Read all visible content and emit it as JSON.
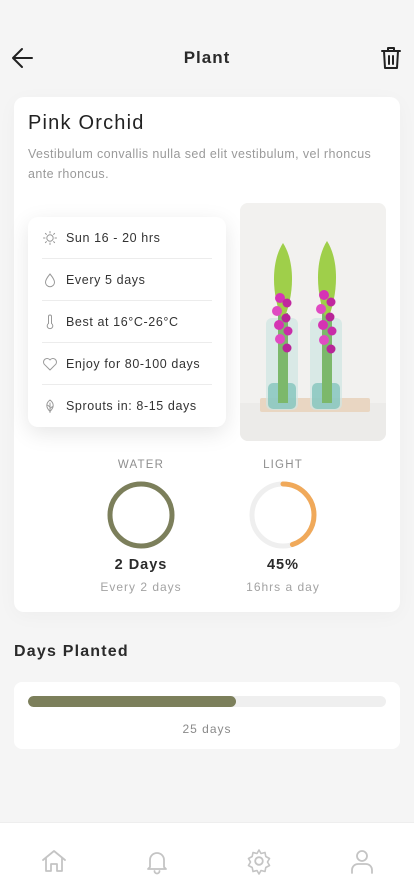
{
  "header": {
    "title": "Plant",
    "back_icon": "arrow-left-icon",
    "delete_icon": "trash-icon"
  },
  "plant": {
    "name": "Pink Orchid",
    "description": " Vestibulum convallis nulla sed elit vestibulum, vel rhoncus ante rhoncus."
  },
  "care_info": [
    {
      "icon": "sun-icon",
      "text": "Sun 16 - 20 hrs"
    },
    {
      "icon": "water-drop-icon",
      "text": "Every 5 days"
    },
    {
      "icon": "thermometer-icon",
      "text": "Best at 16°C-26°C"
    },
    {
      "icon": "heart-icon",
      "text": "Enjoy for 80-100 days"
    },
    {
      "icon": "sprout-icon",
      "text": "Sprouts in: 8-15 days"
    }
  ],
  "gauges": {
    "water": {
      "label": "WATER",
      "value": "2 Days",
      "sub": "Every 2 days",
      "level": 1.0,
      "color": "#7c7f5b"
    },
    "light": {
      "label": "LIGHT",
      "value": "45%",
      "sub": "16hrs a day",
      "level": 0.45,
      "color": "#f0a95a"
    }
  },
  "days_planted": {
    "title": "Days Planted",
    "label": "25 days",
    "progress": 0.58,
    "color": "#7c7f5b"
  },
  "tabbar": [
    {
      "icon": "home-icon"
    },
    {
      "icon": "bell-icon"
    },
    {
      "icon": "settings-gear-icon"
    },
    {
      "icon": "profile-icon"
    }
  ]
}
